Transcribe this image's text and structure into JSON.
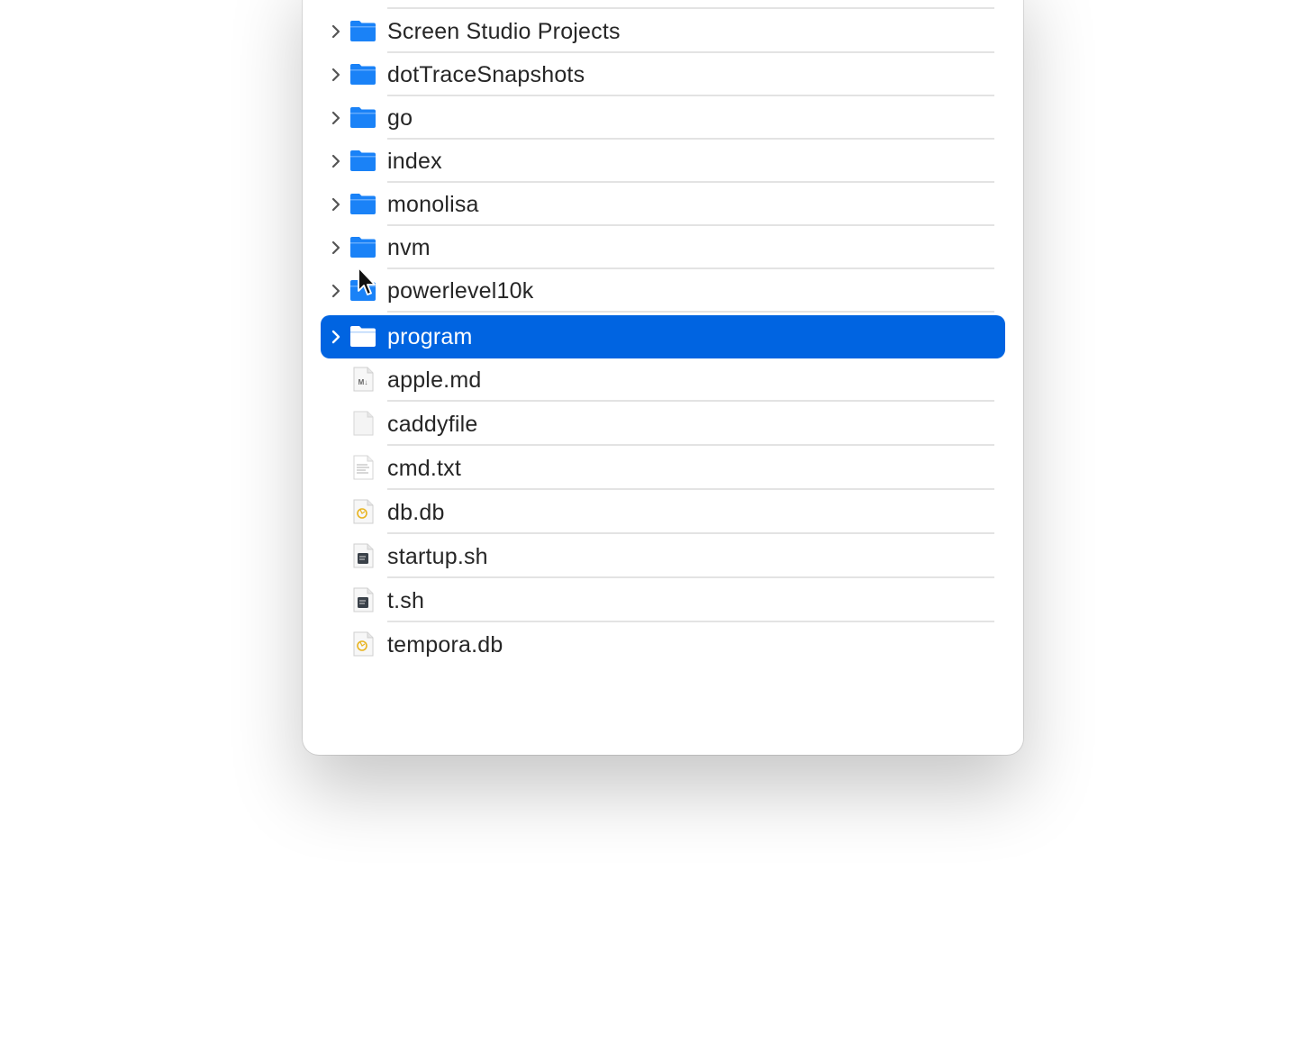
{
  "window": {
    "items": [
      {
        "name": "Screen Studio Projects",
        "kind": "folder",
        "selected": false
      },
      {
        "name": "dotTraceSnapshots",
        "kind": "folder",
        "selected": false
      },
      {
        "name": "go",
        "kind": "folder",
        "selected": false
      },
      {
        "name": "index",
        "kind": "folder",
        "selected": false
      },
      {
        "name": "monolisa",
        "kind": "folder",
        "selected": false
      },
      {
        "name": "nvm",
        "kind": "folder",
        "selected": false
      },
      {
        "name": "powerlevel10k",
        "kind": "folder",
        "selected": false
      },
      {
        "name": "program",
        "kind": "folder",
        "selected": true
      },
      {
        "name": "apple.md",
        "kind": "markdown",
        "selected": false
      },
      {
        "name": "caddyfile",
        "kind": "blank",
        "selected": false
      },
      {
        "name": "cmd.txt",
        "kind": "text",
        "selected": false
      },
      {
        "name": "db.db",
        "kind": "database",
        "selected": false
      },
      {
        "name": "startup.sh",
        "kind": "script",
        "selected": false
      },
      {
        "name": "t.sh",
        "kind": "script",
        "selected": false
      },
      {
        "name": "tempora.db",
        "kind": "database",
        "selected": false
      }
    ],
    "icons": {
      "folder": "folder-icon",
      "markdown": "markdown-file-icon",
      "blank": "document-icon",
      "text": "text-file-icon",
      "database": "database-file-icon",
      "script": "shell-script-icon"
    }
  },
  "colors": {
    "selection": "#0064e1",
    "folder": "#1a82f7",
    "text": "#262626"
  }
}
